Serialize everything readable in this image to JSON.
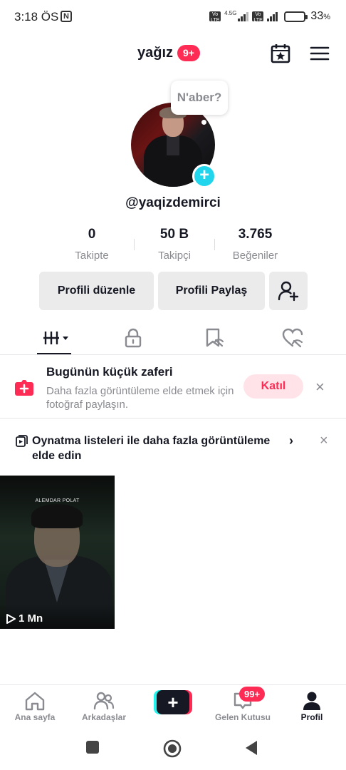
{
  "status_bar": {
    "time": "3:18 ÖS",
    "nfc": "N",
    "volte1": "Vo LTE",
    "network": "4.5G",
    "volte2": "Vo LTE",
    "battery_percent": "33",
    "battery_unit": "%",
    "battery_level": 0.33,
    "battery_color": "#f0b429"
  },
  "header": {
    "username": "yağız",
    "notification_badge": "9+",
    "calendar_icon": "calendar-star-icon",
    "menu_icon": "hamburger-menu-icon"
  },
  "profile": {
    "status_bubble": "N'aber?",
    "handle": "@yaqizdemirci",
    "add_story_icon": "plus-icon",
    "stats": [
      {
        "value": "0",
        "label": "Takipte"
      },
      {
        "value": "50 B",
        "label": "Takipçi"
      },
      {
        "value": "3.765",
        "label": "Beğeniler"
      }
    ]
  },
  "actions": {
    "edit_profile": "Profili düzenle",
    "share_profile": "Profili Paylaş",
    "add_friend_icon": "add-user-icon"
  },
  "tabs": [
    {
      "icon": "videos-grid-icon",
      "active": true
    },
    {
      "icon": "lock-icon",
      "active": false
    },
    {
      "icon": "bookmark-icon",
      "active": false
    },
    {
      "icon": "liked-heart-icon",
      "active": false
    }
  ],
  "promo": {
    "title": "Bugünün küçük zaferi",
    "text": "Daha fazla görüntüleme elde etmek için fotoğraf paylaşın.",
    "join_label": "Katıl",
    "close": "×"
  },
  "playlist": {
    "text": "Oynatma listeleri ile daha fazla görüntüleme elde edin",
    "chevron": "›",
    "close": "×"
  },
  "videos": [
    {
      "caption": "ALEMDAR POLAT",
      "views": "1 Mn"
    }
  ],
  "bottom_nav": {
    "items": [
      {
        "label": "Ana sayfa",
        "icon": "home-icon",
        "active": false
      },
      {
        "label": "Arkadaşlar",
        "icon": "friends-icon",
        "active": false
      },
      {
        "label": "",
        "icon": "create-plus-icon",
        "active": false
      },
      {
        "label": "Gelen Kutusu",
        "icon": "inbox-icon",
        "active": false
      },
      {
        "label": "Profil",
        "icon": "profile-icon",
        "active": true
      }
    ],
    "create_symbol": "+",
    "inbox_badge": "99+"
  },
  "colors": {
    "accent_red": "#fe2c55",
    "accent_cyan": "#20d5ec",
    "text_primary": "#161823",
    "text_secondary": "#8a8b91",
    "button_bg": "#ebebeb"
  }
}
